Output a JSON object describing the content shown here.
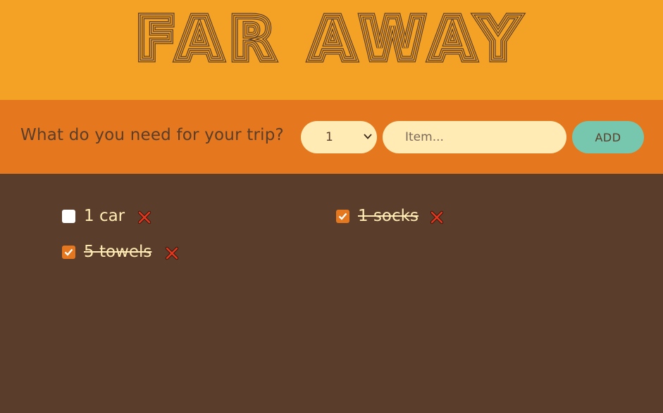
{
  "app": {
    "logo_text": "FAR AWAY",
    "colors": {
      "header_bg": "#f4a226",
      "form_bg": "#e5771e",
      "list_bg": "#5a3e2b",
      "field_bg": "#ffebb3",
      "button_bg": "#76c7ad",
      "delete_icon": "#e5371e"
    }
  },
  "form": {
    "question": "What do you need for your trip?",
    "quantity_selected": "1",
    "item_placeholder": "Item...",
    "item_value": "",
    "add_label": "ADD"
  },
  "items": [
    {
      "text": "1 car",
      "packed": false,
      "delete_icon": "close-icon"
    },
    {
      "text": "1 socks",
      "packed": true,
      "delete_icon": "close-icon"
    },
    {
      "text": "5 towels",
      "packed": true,
      "delete_icon": "close-icon"
    }
  ]
}
